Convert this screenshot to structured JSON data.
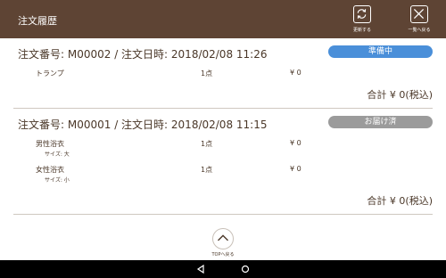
{
  "header": {
    "title": "注文履歴",
    "refresh_label": "更新する",
    "back_label": "一覧へ戻る"
  },
  "orders": [
    {
      "title": "注文番号: M00002 / 注文日時: 2018/02/08 11:26",
      "status": "準備中",
      "status_color": "#4a8fd9",
      "items": [
        {
          "name": "トランプ",
          "size": "",
          "qty": "1点",
          "price": "¥ 0"
        }
      ],
      "total": "合計 ¥ 0(税込)"
    },
    {
      "title": "注文番号: M00001 / 注文日時: 2018/02/08 11:15",
      "status": "お届け済",
      "status_color": "#9b9b9b",
      "items": [
        {
          "name": "男性浴衣",
          "size": "サイズ: 大",
          "qty": "1点",
          "price": "¥ 0"
        },
        {
          "name": "女性浴衣",
          "size": "サイズ: 小",
          "qty": "1点",
          "price": "¥ 0"
        }
      ],
      "total": "合計 ¥ 0(税込)"
    }
  ],
  "footer": {
    "top_label": "TOPへ戻る"
  },
  "icons": {
    "refresh": "refresh-icon",
    "close": "close-icon",
    "chevron_up": "chevron-up-icon",
    "nav_back": "nav-back-icon",
    "nav_home": "nav-home-icon"
  },
  "colors": {
    "header_bg": "#5e4434",
    "text": "#4a3728",
    "badge_preparing": "#4a8fd9",
    "badge_delivered": "#9b9b9b",
    "nav_bar": "#000000"
  }
}
